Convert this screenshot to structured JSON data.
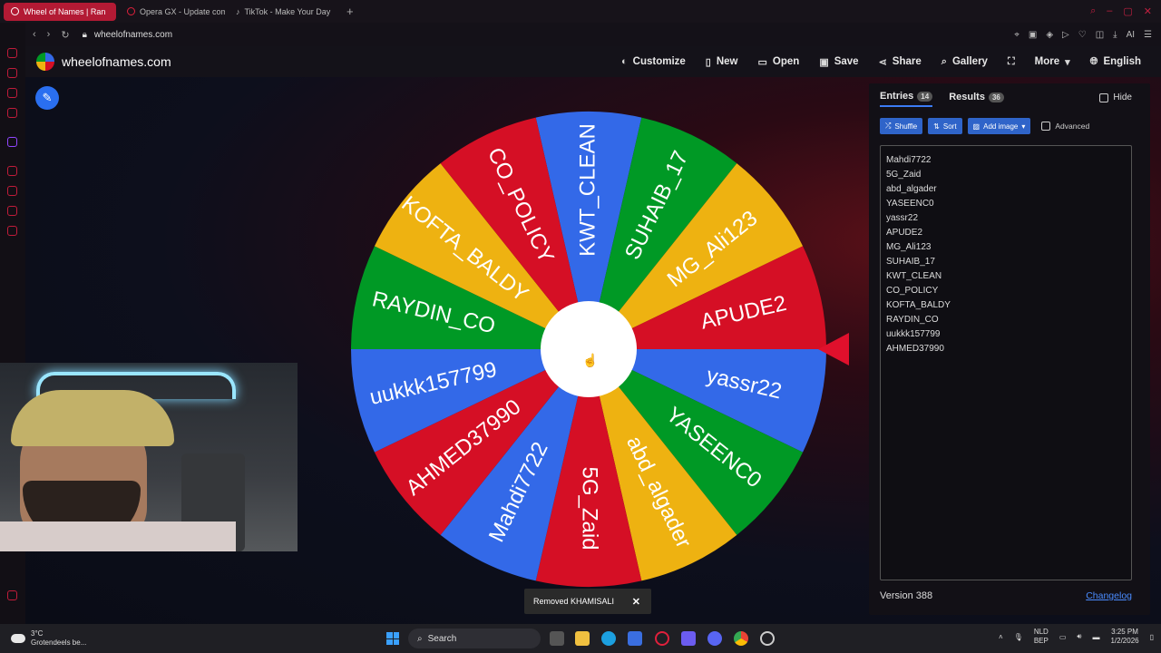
{
  "browser": {
    "tabs": [
      {
        "title": "Wheel of Names | Ran",
        "active": true
      },
      {
        "title": "Opera GX - Update comp",
        "active": false
      },
      {
        "title": "TikTok - Make Your Day",
        "active": false
      }
    ],
    "new_tab": "+",
    "url": "wheelofnames.com",
    "ai_label": "AI"
  },
  "site": {
    "name": "wheelofnames.com",
    "menu": {
      "customize": "Customize",
      "new": "New",
      "open": "Open",
      "save": "Save",
      "share": "Share",
      "gallery": "Gallery",
      "more": "More",
      "language": "English"
    }
  },
  "wheel": {
    "segments": [
      {
        "name": "KWT_CLEAN",
        "color": "#3369e8"
      },
      {
        "name": "SUHAIB_17",
        "color": "#009925"
      },
      {
        "name": "MG_Ali123",
        "color": "#eeb211"
      },
      {
        "name": "APUDE2",
        "color": "#d50f25"
      },
      {
        "name": "yassr22",
        "color": "#3369e8"
      },
      {
        "name": "YASEENC0",
        "color": "#009925"
      },
      {
        "name": "abd_algader",
        "color": "#eeb211"
      },
      {
        "name": "5G_Zaid",
        "color": "#d50f25"
      },
      {
        "name": "Mahdi7722",
        "color": "#3369e8"
      },
      {
        "name": "AHMED37990",
        "color": "#d50f25"
      },
      {
        "name": "uukkk157799",
        "color": "#3369e8"
      },
      {
        "name": "RAYDIN_CO",
        "color": "#009925"
      },
      {
        "name": "KOFTA_BALDY",
        "color": "#eeb211"
      },
      {
        "name": "CO_POLICY",
        "color": "#d50f25"
      }
    ],
    "pointer_color": "#e0102c"
  },
  "panel": {
    "tabs": {
      "entries_label": "Entries",
      "entries_count": "14",
      "results_label": "Results",
      "results_count": "36"
    },
    "hide_label": "Hide",
    "buttons": {
      "shuffle": "Shuffle",
      "sort": "Sort",
      "add_image": "Add image",
      "advanced": "Advanced"
    },
    "entries": [
      "Mahdi7722",
      "5G_Zaid",
      "abd_algader",
      "YASEENC0",
      "yassr22",
      "APUDE2",
      "MG_Ali123",
      "SUHAIB_17",
      "KWT_CLEAN",
      "CO_POLICY",
      "KOFTA_BALDY",
      "RAYDIN_CO",
      "uukkk157799",
      "AHMED37990"
    ],
    "version": "Version 388",
    "changelog": "Changelog"
  },
  "toast": {
    "message": "Removed KHAMISALI",
    "close": "✕"
  },
  "taskbar": {
    "weather_temp": "3°C",
    "weather_desc": "Grotendeels be...",
    "search": "Search",
    "lang_line1": "NLD",
    "lang_line2": "BEP",
    "time": "3:25 PM",
    "date": "1/2/2026"
  }
}
